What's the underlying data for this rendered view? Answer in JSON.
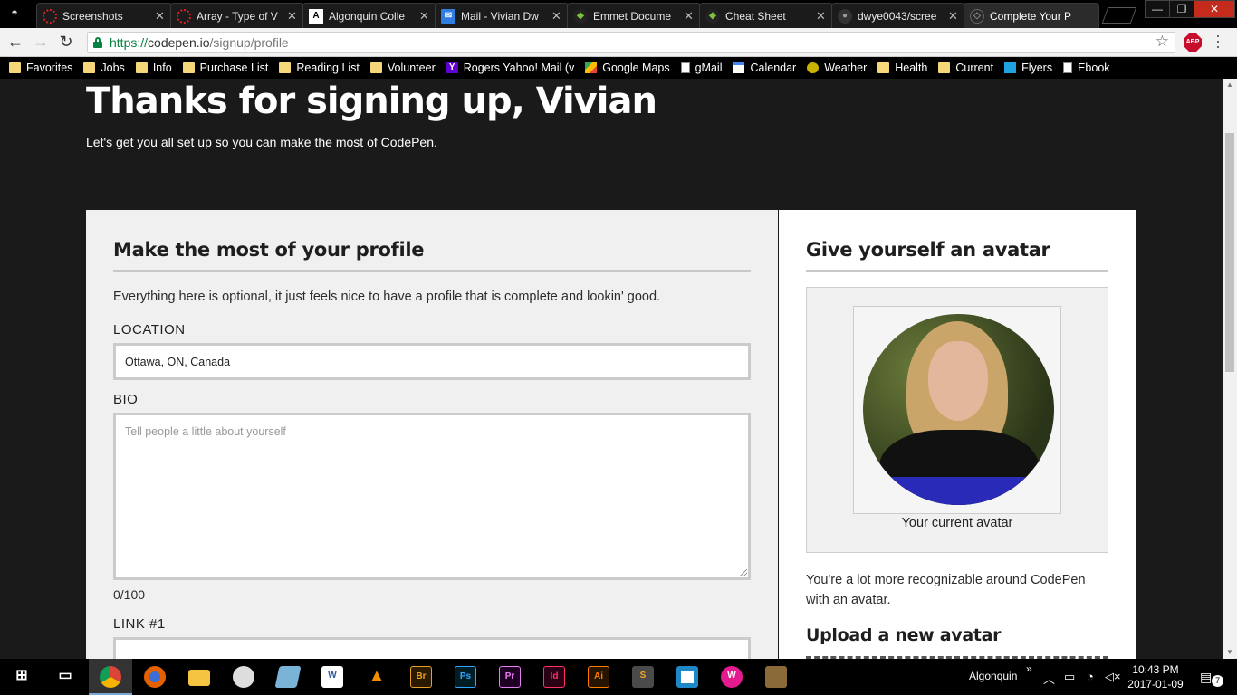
{
  "browser": {
    "tabs": [
      {
        "title": "Screenshots",
        "icon": "screenshots-icon",
        "color": "#e02020"
      },
      {
        "title": "Array - Type of V",
        "icon": "array-icon",
        "color": "#e02020"
      },
      {
        "title": "Algonquin Colle",
        "icon": "algonquin-icon",
        "color": "#ffffff"
      },
      {
        "title": "Mail - Vivian Dw",
        "icon": "mail-icon",
        "color": "#2f7de1"
      },
      {
        "title": "Emmet Docume",
        "icon": "emmet-icon",
        "color": "#7bbf3c"
      },
      {
        "title": "Cheat Sheet",
        "icon": "emmet-icon",
        "color": "#7bbf3c"
      },
      {
        "title": "dwye0043/scree",
        "icon": "github-icon",
        "color": "#444444"
      },
      {
        "title": "Complete Your P",
        "icon": "codepen-icon",
        "color": "#888888"
      }
    ],
    "address": {
      "proto": "https://",
      "host": "codepen.io",
      "path": "/signup/profile"
    },
    "abp_label": "ABP",
    "bookmarks": [
      {
        "label": "Favorites",
        "icon": "folder"
      },
      {
        "label": "Jobs",
        "icon": "folder"
      },
      {
        "label": "Info",
        "icon": "folder"
      },
      {
        "label": "Purchase List",
        "icon": "folder"
      },
      {
        "label": "Reading List",
        "icon": "folder"
      },
      {
        "label": "Volunteer",
        "icon": "folder"
      },
      {
        "label": "Rogers Yahoo! Mail (v",
        "icon": "yahoo"
      },
      {
        "label": "Google Maps",
        "icon": "maps"
      },
      {
        "label": "gMail",
        "icon": "page"
      },
      {
        "label": "Calendar",
        "icon": "cal"
      },
      {
        "label": "Weather",
        "icon": "weather"
      },
      {
        "label": "Health",
        "icon": "folder"
      },
      {
        "label": "Current",
        "icon": "folder"
      },
      {
        "label": "Flyers",
        "icon": "flyers"
      },
      {
        "label": "Ebook",
        "icon": "page"
      }
    ]
  },
  "page": {
    "hero_title": "Thanks for signing up, Vivian",
    "hero_sub": "Let's get you all set up so you can make the most of CodePen.",
    "profile": {
      "heading": "Make the most of your profile",
      "intro": "Everything here is optional, it just feels nice to have a profile that is complete and lookin' good.",
      "location_label": "LOCATION",
      "location_value": "Ottawa, ON, Canada",
      "bio_label": "BIO",
      "bio_placeholder": "Tell people a little about yourself",
      "bio_count": "0/100",
      "link1_label": "LINK #1"
    },
    "avatar": {
      "heading": "Give yourself an avatar",
      "caption": "Your current avatar",
      "blurb_line1": "You're a lot more recognizable around CodePen",
      "blurb_line2": "with an avatar.",
      "upload_heading": "Upload a new avatar"
    }
  },
  "taskbar": {
    "apps": [
      {
        "name": "chrome",
        "label": ""
      },
      {
        "name": "firefox",
        "label": ""
      },
      {
        "name": "file-explorer",
        "label": ""
      },
      {
        "name": "paint",
        "label": ""
      },
      {
        "name": "notepad",
        "label": ""
      },
      {
        "name": "word",
        "label": "W"
      },
      {
        "name": "vlc",
        "label": ""
      },
      {
        "name": "bridge",
        "label": "Br"
      },
      {
        "name": "photoshop",
        "label": "Ps"
      },
      {
        "name": "premiere",
        "label": "Pr"
      },
      {
        "name": "indesign",
        "label": "Id"
      },
      {
        "name": "illustrator",
        "label": "Ai"
      },
      {
        "name": "sublime",
        "label": "S"
      },
      {
        "name": "brackets",
        "label": ""
      },
      {
        "name": "wamp",
        "label": "W"
      },
      {
        "name": "gimp",
        "label": ""
      }
    ],
    "tray_label": "Algonquin",
    "tray_chevron": "»",
    "time": "10:43 PM",
    "date": "2017-01-09",
    "notifications": "7"
  }
}
